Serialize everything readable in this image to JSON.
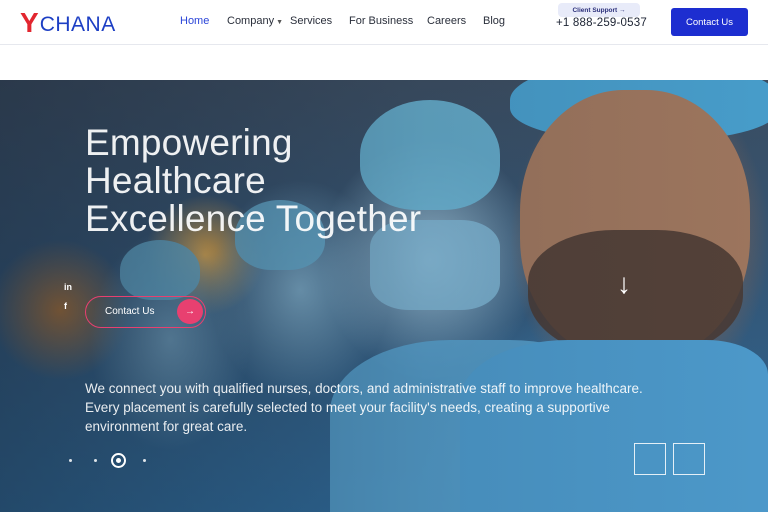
{
  "brand": {
    "logo_y": "Y",
    "logo_rest": "chana"
  },
  "nav": {
    "items": [
      {
        "label": "Home",
        "active": true
      },
      {
        "label": "Company",
        "has_dropdown": true
      },
      {
        "label": "Services"
      },
      {
        "label": "For Business"
      },
      {
        "label": "Careers"
      },
      {
        "label": "Blog"
      }
    ]
  },
  "support": {
    "label": "Client Support →",
    "phone": "+1 888-259-0537"
  },
  "header_cta": {
    "label": "Contact Us"
  },
  "hero": {
    "headline": [
      "Empowering",
      "Healthcare",
      "Excellence Together"
    ],
    "social": [
      "in",
      "f"
    ],
    "cta_label": "Contact Us",
    "cta_arrow": "→",
    "scroll_icon": "↓",
    "description": "We connect you with qualified nurses, doctors, and administrative staff to improve healthcare. Every placement is carefully selected to meet your facility's needs, creating a supportive environment for great care.",
    "slides": {
      "count": 4,
      "active_index": 2
    }
  },
  "colors": {
    "brand_red": "#e2262f",
    "brand_blue": "#1d3fc4",
    "cta_blue": "#1d2ed0",
    "accent_pink": "#e84070",
    "nav_active": "#2a44d8"
  },
  "icons": {
    "linkedin": "linkedin-icon",
    "facebook": "facebook-icon",
    "arrow_right": "arrow-right-icon",
    "scroll_down": "arrow-down-icon",
    "caret": "chevron-down-icon"
  }
}
